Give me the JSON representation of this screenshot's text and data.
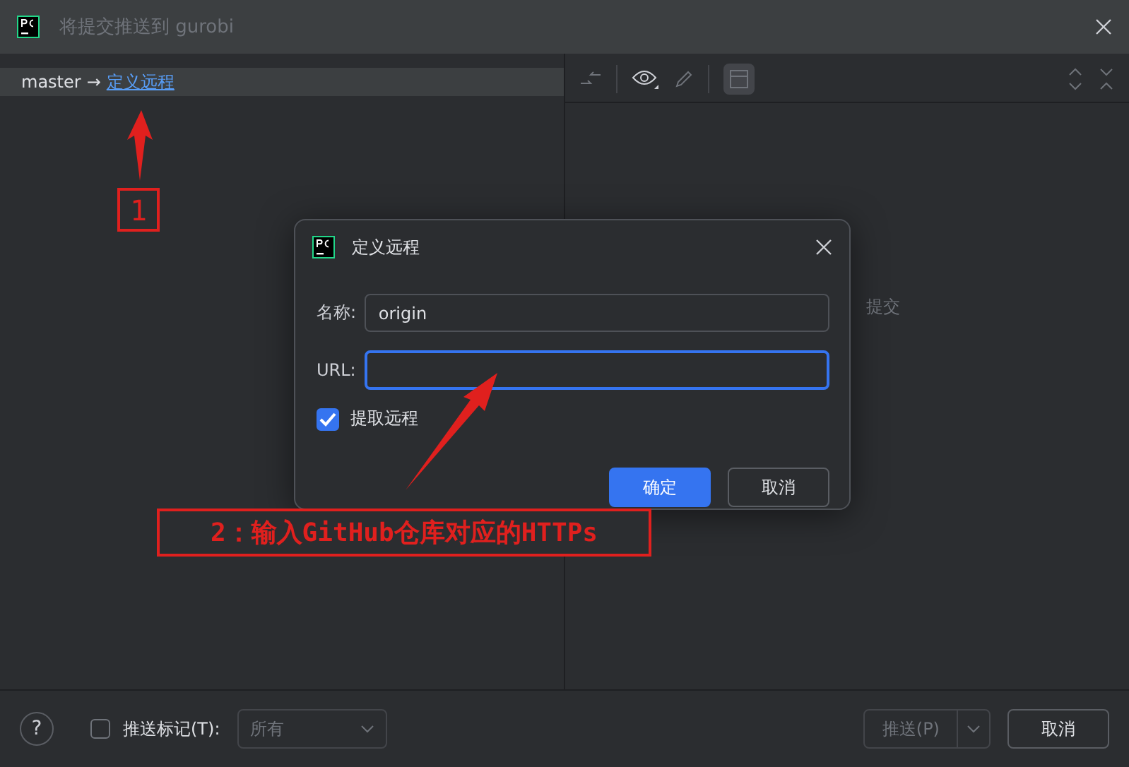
{
  "window": {
    "title": "将提交推送到 gurobi"
  },
  "branch_row": {
    "branch": "master",
    "arrow": "→",
    "link": "定义远程",
    "selected": true
  },
  "diff_panel": {
    "hint": "提交"
  },
  "bottom_bar": {
    "help": "?",
    "push_tags": {
      "label": "推送标记(T):",
      "checked": false
    },
    "tags_dropdown": {
      "value": "所有",
      "disabled": true
    },
    "push_button": {
      "label": "推送(P)",
      "disabled": true
    },
    "cancel_button": "取消"
  },
  "dialog": {
    "title": "定义远程",
    "fields": [
      {
        "label": "名称:",
        "value": "origin",
        "focused": false
      },
      {
        "label": "URL:",
        "focused": true
      }
    ],
    "fetch": {
      "label": "提取远程",
      "checked": true
    },
    "buttons": [
      {
        "label": "确定",
        "kind": "primary"
      },
      {
        "label": "取消",
        "kind": "secondary"
      }
    ]
  },
  "annotations": [
    {
      "kind": "number",
      "text": "1"
    },
    {
      "kind": "note",
      "text": "2：输入GitHub仓库对应的HTTPs"
    }
  ]
}
